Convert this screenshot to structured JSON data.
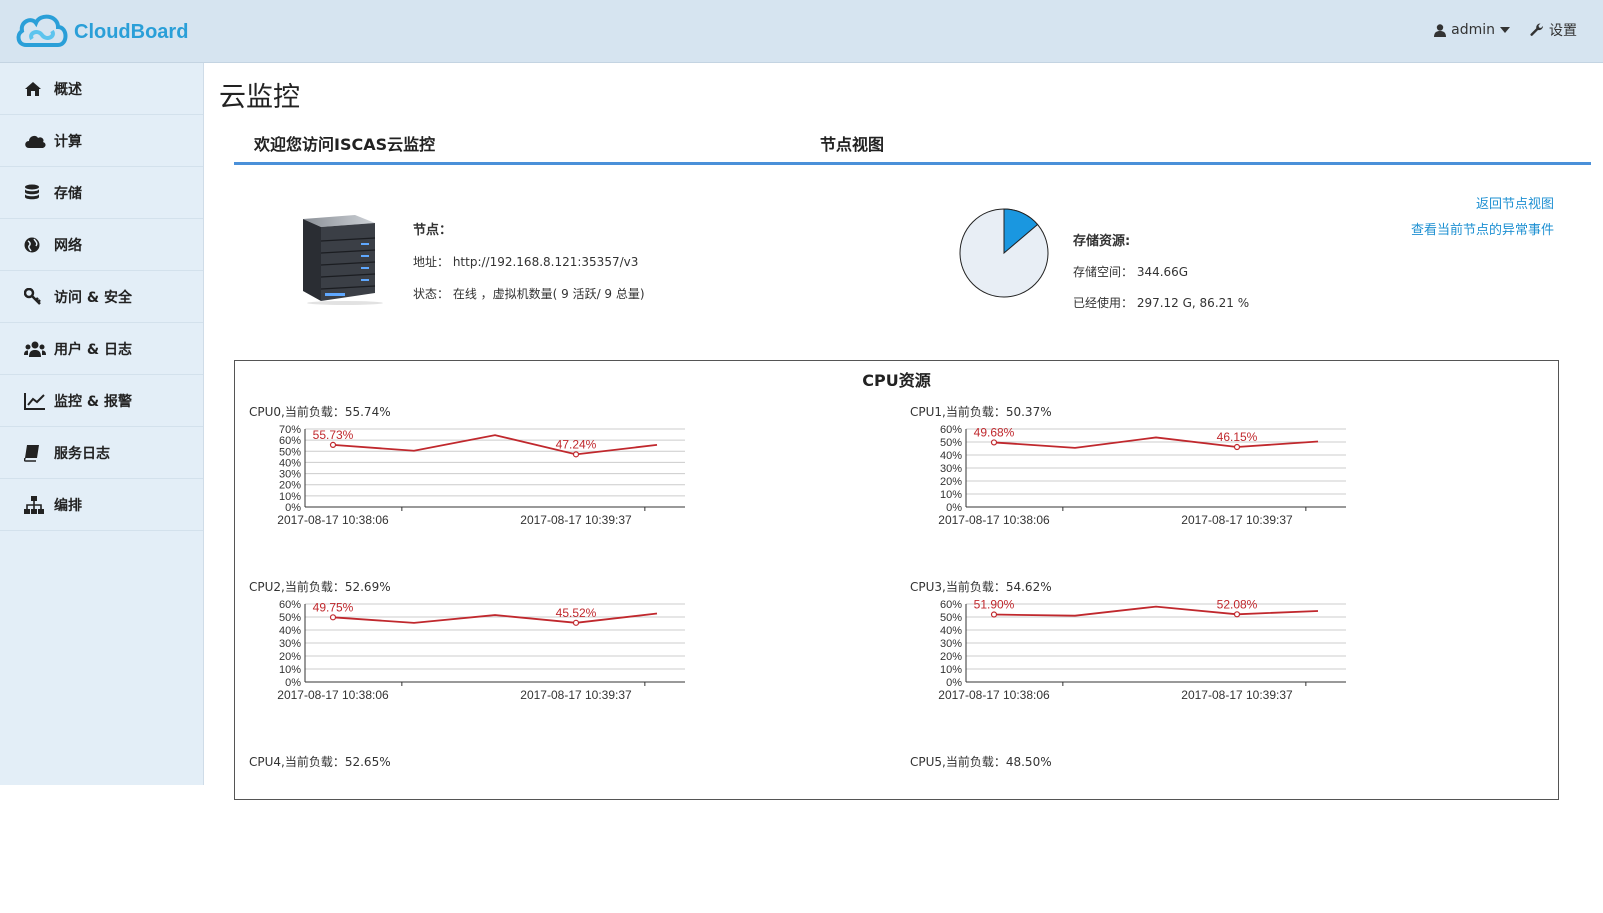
{
  "header": {
    "logo_text": "CloudBoard",
    "user_label": "admin",
    "settings_label": "设置"
  },
  "sidebar": {
    "items": [
      {
        "label": "概述",
        "icon": "home-icon"
      },
      {
        "label": "计算",
        "icon": "cloud-icon"
      },
      {
        "label": "存储",
        "icon": "database-icon"
      },
      {
        "label": "网络",
        "icon": "globe-icon"
      },
      {
        "label": "访问 & 安全",
        "icon": "key-icon"
      },
      {
        "label": "用户 & 日志",
        "icon": "users-icon"
      },
      {
        "label": "监控 & 报警",
        "icon": "line-chart-icon"
      },
      {
        "label": "服务日志",
        "icon": "book-icon"
      },
      {
        "label": "编排",
        "icon": "sitemap-icon"
      }
    ]
  },
  "main": {
    "title": "云监控",
    "tabs": [
      {
        "label": "欢迎您访问ISCAS云监控"
      },
      {
        "label": "节点视图"
      }
    ],
    "node": {
      "heading": "节点：",
      "address": "地址： http://192.168.8.121:35357/v3",
      "status": "状态： 在线 ，虚拟机数量( 9 活跃/ 9 总量)"
    },
    "storage": {
      "heading": "存储资源:",
      "space": "存储空间： 344.66G",
      "used": "已经使用： 297.12 G, 86.21 %",
      "used_percent": 86.21
    },
    "links": {
      "back": "返回节点视图",
      "events": "查看当前节点的异常事件"
    },
    "cpu_panel_title": "CPU资源"
  },
  "colors": {
    "accent": "#4a90d9",
    "link": "#1e90d2",
    "line": "#c0282d",
    "pie_used": "#e8eef5",
    "pie_free": "#1a97e0"
  },
  "chart_data": [
    {
      "type": "line",
      "title": "CPU0,当前负载：55.74%",
      "x_ticks": [
        "2017-08-17 10:38:06",
        "2017-08-17 10:39:37"
      ],
      "y_ticks": [
        "0%",
        "10%",
        "20%",
        "30%",
        "40%",
        "50%",
        "60%",
        "70%"
      ],
      "ylim": [
        0,
        70
      ],
      "values": [
        55.73,
        50.5,
        64.5,
        47.24,
        55.74
      ],
      "labels": [
        "55.73%",
        "47.24%"
      ]
    },
    {
      "type": "line",
      "title": "CPU1,当前负载：50.37%",
      "x_ticks": [
        "2017-08-17 10:38:06",
        "2017-08-17 10:39:37"
      ],
      "y_ticks": [
        "0%",
        "10%",
        "20%",
        "30%",
        "40%",
        "50%",
        "60%"
      ],
      "ylim": [
        0,
        60
      ],
      "values": [
        49.68,
        45.5,
        53.5,
        46.15,
        50.37
      ],
      "labels": [
        "49.68%",
        "46.15%"
      ]
    },
    {
      "type": "line",
      "title": "CPU2,当前负载：52.69%",
      "x_ticks": [
        "2017-08-17 10:38:06",
        "2017-08-17 10:39:37"
      ],
      "y_ticks": [
        "0%",
        "10%",
        "20%",
        "30%",
        "40%",
        "50%",
        "60%"
      ],
      "ylim": [
        0,
        60
      ],
      "values": [
        49.75,
        45.5,
        51.5,
        45.52,
        52.69
      ],
      "labels": [
        "49.75%",
        "45.52%"
      ]
    },
    {
      "type": "line",
      "title": "CPU3,当前负载：54.62%",
      "x_ticks": [
        "2017-08-17 10:38:06",
        "2017-08-17 10:39:37"
      ],
      "y_ticks": [
        "0%",
        "10%",
        "20%",
        "30%",
        "40%",
        "50%",
        "60%"
      ],
      "ylim": [
        0,
        60
      ],
      "values": [
        51.9,
        51.0,
        58.0,
        52.08,
        54.62
      ],
      "labels": [
        "51.90%",
        "52.08%"
      ]
    },
    {
      "type": "line",
      "title": "CPU4,当前负载：52.65%",
      "x_ticks": [],
      "y_ticks": [],
      "values": [],
      "labels": []
    },
    {
      "type": "line",
      "title": "CPU5,当前负载：48.50%",
      "x_ticks": [],
      "y_ticks": [],
      "values": [],
      "labels": []
    }
  ]
}
